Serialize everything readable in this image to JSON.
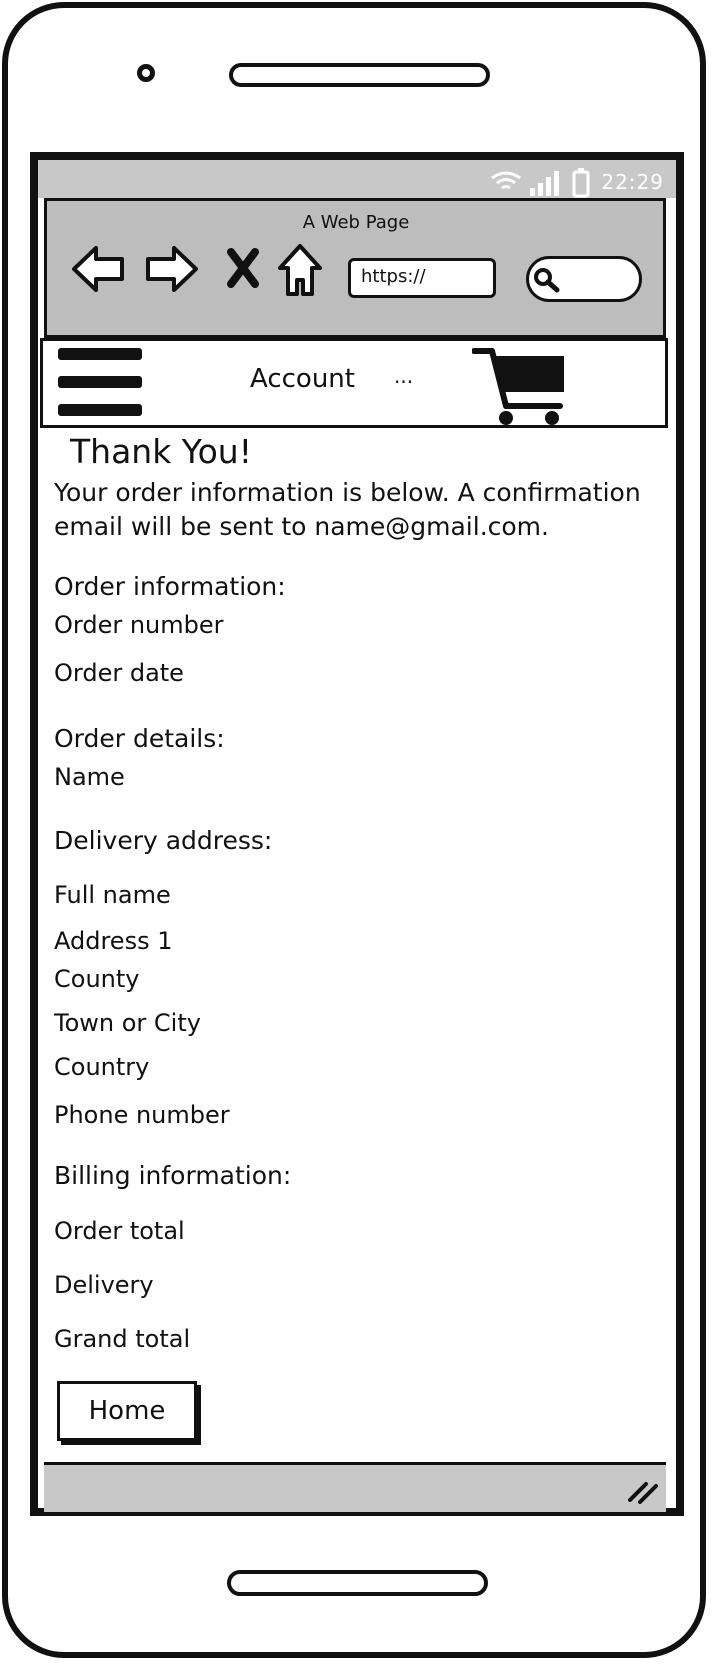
{
  "status_bar": {
    "time": "22:29",
    "wifi_icon": "wifi-icon",
    "signal_icon": "signal-icon",
    "battery_icon": "battery-icon"
  },
  "browser": {
    "title": "A Web Page",
    "url_placeholder": "https://",
    "icons": [
      "back-arrow-icon",
      "forward-arrow-icon",
      "close-icon",
      "home-icon",
      "search-icon"
    ]
  },
  "navbar": {
    "menu_icon": "hamburger-menu-icon",
    "account_label": "Account",
    "more_label": "...",
    "cart_icon": "shopping-cart-icon"
  },
  "page": {
    "heading": "Thank You!",
    "intro": "Your order information is below. A confirmation email will be sent to name@gmail.com.",
    "order_information": {
      "title": "Order information:",
      "rows": [
        "Order number",
        "Order date"
      ]
    },
    "order_details": {
      "title": "Order details:",
      "rows": [
        "Name"
      ]
    },
    "delivery_address": {
      "title": "Delivery address:",
      "rows": [
        "Full name",
        "Address 1",
        "County",
        "Town or City",
        "Country",
        "Phone number"
      ]
    },
    "billing_information": {
      "title": "Billing information:",
      "rows": [
        "Order total",
        "Delivery",
        "Grand total"
      ]
    },
    "home_button": "Home"
  }
}
